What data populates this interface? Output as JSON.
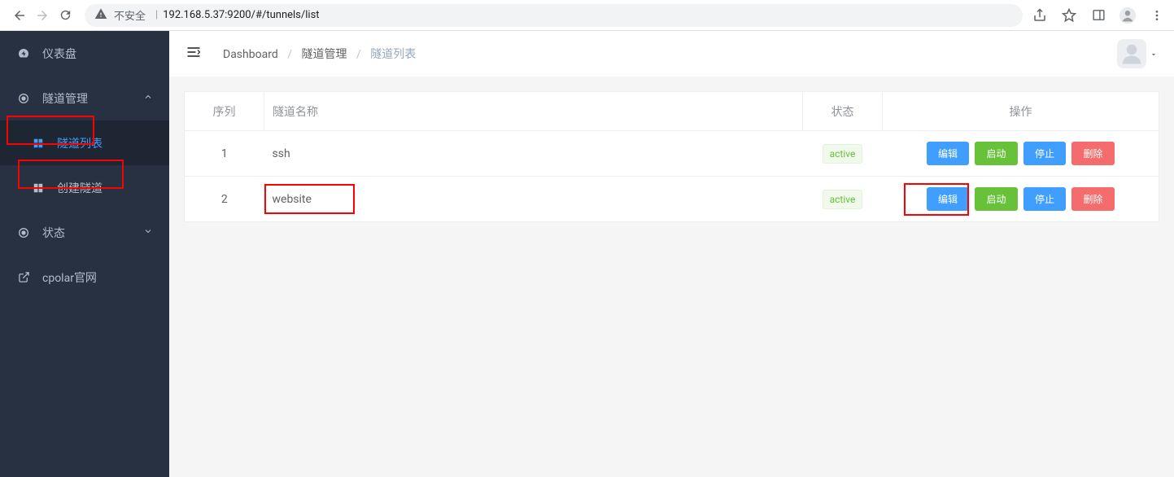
{
  "browser": {
    "unsafe_label": "不安全",
    "url": "192.168.5.37:9200/#/tunnels/list"
  },
  "sidebar": {
    "items": [
      {
        "label": "仪表盘"
      },
      {
        "label": "隧道管理"
      },
      {
        "label": "隧道列表"
      },
      {
        "label": "创建隧道"
      },
      {
        "label": "状态"
      },
      {
        "label": "cpolar官网"
      }
    ]
  },
  "breadcrumb": {
    "items": [
      "Dashboard",
      "隧道管理",
      "隧道列表"
    ]
  },
  "table": {
    "headers": {
      "seq": "序列",
      "name": "隧道名称",
      "status": "状态",
      "action": "操作"
    },
    "rows": [
      {
        "seq": "1",
        "name": "ssh",
        "status": "active"
      },
      {
        "seq": "2",
        "name": "website",
        "status": "active"
      }
    ],
    "actions": {
      "edit": "编辑",
      "start": "启动",
      "stop": "停止",
      "delete": "删除"
    }
  }
}
